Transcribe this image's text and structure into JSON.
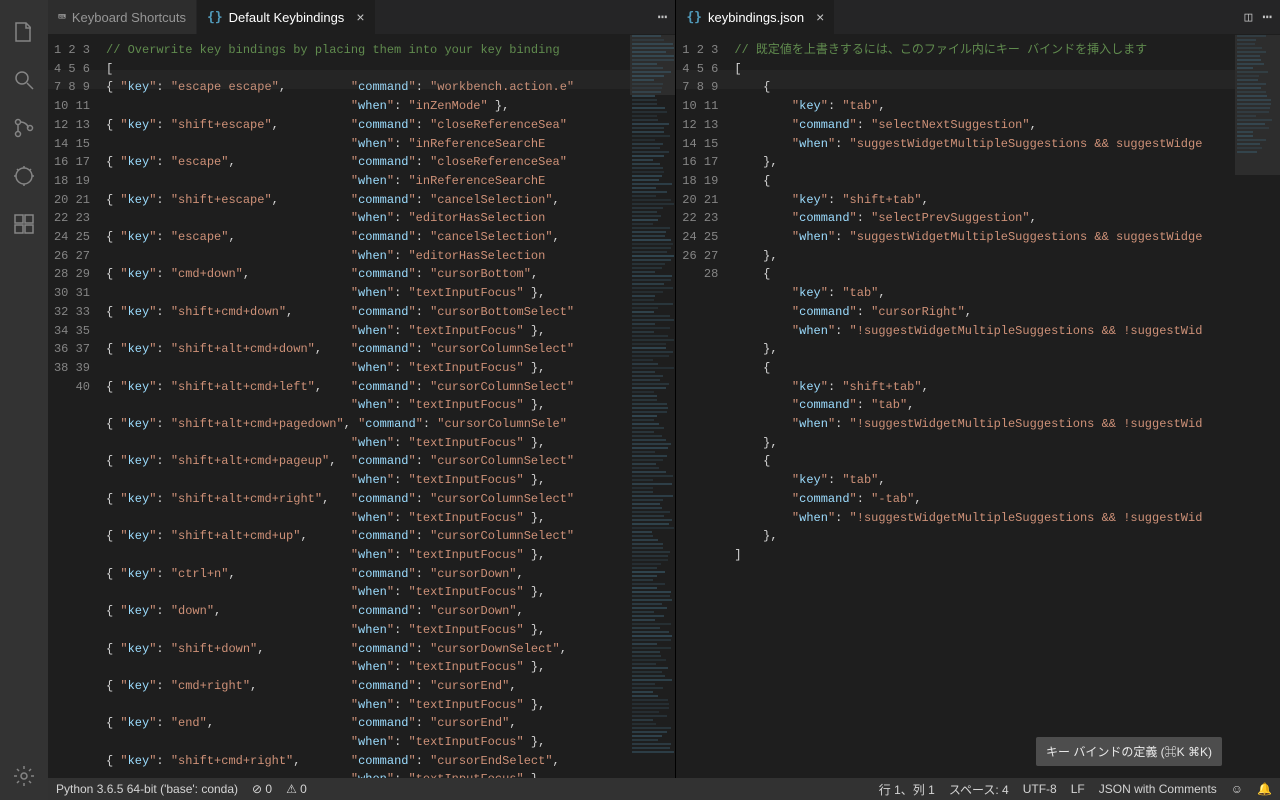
{
  "activity": {
    "icons": [
      "files",
      "search",
      "source-control",
      "debug",
      "extensions"
    ],
    "bottom": "settings-gear"
  },
  "tabs_left": [
    {
      "icon": "kbd",
      "label": "Keyboard Shortcuts",
      "active": false,
      "closable": false
    },
    {
      "icon": "json",
      "label": "Default Keybindings",
      "active": true,
      "closable": true
    }
  ],
  "tabs_right": [
    {
      "icon": "json",
      "label": "keybindings.json",
      "active": true,
      "closable": true
    }
  ],
  "left_editor": {
    "start_line": 1,
    "lines": [
      {
        "type": "comment",
        "text": "// Overwrite key bindings by placing them into your key binding"
      },
      {
        "type": "punc",
        "text": "["
      },
      {
        "type": "obj",
        "key": "escape escape",
        "command": "workbench.action.e",
        "more": true
      },
      {
        "type": "when",
        "when": "inZenMode",
        "close": true
      },
      {
        "type": "obj",
        "key": "shift+escape",
        "command": "closeReferenceSea",
        "more": true
      },
      {
        "type": "when",
        "when": "inReferenceSearchE",
        "trunc": true
      },
      {
        "type": "obj",
        "key": "escape",
        "command": "closeReferenceSea",
        "more": true
      },
      {
        "type": "when",
        "when": "inReferenceSearchE",
        "trunc": true
      },
      {
        "type": "obj",
        "key": "shift+escape",
        "command": "cancelSelection",
        "comma": true
      },
      {
        "type": "when",
        "when": "editorHasSelection",
        "trunc": true
      },
      {
        "type": "obj",
        "key": "escape",
        "command": "cancelSelection",
        "comma": true
      },
      {
        "type": "when",
        "when": "editorHasSelection",
        "trunc": true
      },
      {
        "type": "obj",
        "key": "cmd+down",
        "command": "cursorBottom",
        "comma": true
      },
      {
        "type": "when",
        "when": "textInputFocus",
        "close": true
      },
      {
        "type": "obj",
        "key": "shift+cmd+down",
        "command": "cursorBottomSelect",
        "more": true
      },
      {
        "type": "when",
        "when": "textInputFocus",
        "close": true
      },
      {
        "type": "obj",
        "key": "shift+alt+cmd+down",
        "command": "cursorColumnSelect",
        "more": true
      },
      {
        "type": "when",
        "when": "textInputFocus",
        "close": true
      },
      {
        "type": "obj",
        "key": "shift+alt+cmd+left",
        "command": "cursorColumnSelect",
        "more": true
      },
      {
        "type": "when",
        "when": "textInputFocus",
        "close": true
      },
      {
        "type": "obj",
        "key": "shift+alt+cmd+pagedown",
        "command": "cursorColumnSele",
        "more": true
      },
      {
        "type": "when",
        "when": "textInputFocus",
        "close": true
      },
      {
        "type": "obj",
        "key": "shift+alt+cmd+pageup",
        "command": "cursorColumnSelect",
        "more": true
      },
      {
        "type": "when",
        "when": "textInputFocus",
        "close": true
      },
      {
        "type": "obj",
        "key": "shift+alt+cmd+right",
        "command": "cursorColumnSelect",
        "more": true
      },
      {
        "type": "when",
        "when": "textInputFocus",
        "close": true
      },
      {
        "type": "obj",
        "key": "shift+alt+cmd+up",
        "command": "cursorColumnSelect",
        "more": true
      },
      {
        "type": "when",
        "when": "textInputFocus",
        "close": true
      },
      {
        "type": "obj",
        "key": "ctrl+n",
        "command": "cursorDown",
        "comma": true
      },
      {
        "type": "when",
        "when": "textInputFocus",
        "close": true
      },
      {
        "type": "obj",
        "key": "down",
        "command": "cursorDown",
        "comma": true
      },
      {
        "type": "when",
        "when": "textInputFocus",
        "close": true
      },
      {
        "type": "obj",
        "key": "shift+down",
        "command": "cursorDownSelect",
        "comma": true
      },
      {
        "type": "when",
        "when": "textInputFocus",
        "close": true
      },
      {
        "type": "obj",
        "key": "cmd+right",
        "command": "cursorEnd",
        "comma": true
      },
      {
        "type": "when",
        "when": "textInputFocus",
        "close": true
      },
      {
        "type": "obj",
        "key": "end",
        "command": "cursorEnd",
        "comma": true
      },
      {
        "type": "when",
        "when": "textInputFocus",
        "close": true
      },
      {
        "type": "obj",
        "key": "shift+cmd+right",
        "command": "cursorEndSelect",
        "comma": true
      },
      {
        "type": "when",
        "when": "textInputFocus",
        "close": true
      }
    ]
  },
  "right_editor": {
    "start_line": 1,
    "lines": [
      {
        "t": "comment",
        "s": "// 既定値を上書きするには、このファイル内にキー バインドを挿入します"
      },
      {
        "t": "raw",
        "s": "["
      },
      {
        "t": "raw",
        "s": "    {"
      },
      {
        "t": "kv",
        "k": "key",
        "v": "tab",
        "comma": true,
        "pad": "        "
      },
      {
        "t": "kv",
        "k": "command",
        "v": "selectNextSuggestion",
        "comma": true,
        "pad": "        "
      },
      {
        "t": "kv",
        "k": "when",
        "v": "suggestWidgetMultipleSuggestions && suggestWidge",
        "pad": "        ",
        "trunc": true
      },
      {
        "t": "raw",
        "s": "    },"
      },
      {
        "t": "raw",
        "s": "    {"
      },
      {
        "t": "kv",
        "k": "key",
        "v": "shift+tab",
        "comma": true,
        "pad": "        "
      },
      {
        "t": "kv",
        "k": "command",
        "v": "selectPrevSuggestion",
        "comma": true,
        "pad": "        "
      },
      {
        "t": "kv",
        "k": "when",
        "v": "suggestWidgetMultipleSuggestions && suggestWidge",
        "pad": "        ",
        "trunc": true
      },
      {
        "t": "raw",
        "s": "    },"
      },
      {
        "t": "raw",
        "s": "    {"
      },
      {
        "t": "kv",
        "k": "key",
        "v": "tab",
        "comma": true,
        "pad": "        "
      },
      {
        "t": "kv",
        "k": "command",
        "v": "cursorRight",
        "comma": true,
        "pad": "        "
      },
      {
        "t": "kv",
        "k": "when",
        "v": "!suggestWidgetMultipleSuggestions && !suggestWid",
        "pad": "        ",
        "trunc": true
      },
      {
        "t": "raw",
        "s": "    },"
      },
      {
        "t": "raw",
        "s": "    {"
      },
      {
        "t": "kv",
        "k": "key",
        "v": "shift+tab",
        "comma": true,
        "pad": "        "
      },
      {
        "t": "kv",
        "k": "command",
        "v": "tab",
        "comma": true,
        "pad": "        "
      },
      {
        "t": "kv",
        "k": "when",
        "v": "!suggestWidgetMultipleSuggestions && !suggestWid",
        "pad": "        ",
        "trunc": true
      },
      {
        "t": "raw",
        "s": "    },"
      },
      {
        "t": "raw",
        "s": "    {"
      },
      {
        "t": "kv",
        "k": "key",
        "v": "tab",
        "comma": true,
        "pad": "        "
      },
      {
        "t": "kv",
        "k": "command",
        "v": "-tab",
        "comma": true,
        "pad": "        "
      },
      {
        "t": "kv",
        "k": "when",
        "v": "!suggestWidgetMultipleSuggestions && !suggestWid",
        "pad": "        ",
        "trunc": true
      },
      {
        "t": "raw",
        "s": "    },"
      },
      {
        "t": "raw",
        "s": "]"
      }
    ]
  },
  "float_button": "キー バインドの定義 (⌘K ⌘K)",
  "status": {
    "python": "Python 3.6.5 64-bit ('base': conda)",
    "errors": "⊘ 0",
    "warnings": "⚠ 0",
    "lncol": "行 1、列 1",
    "spaces": "スペース: 4",
    "encoding": "UTF-8",
    "eol": "LF",
    "lang": "JSON with Comments",
    "smile": "☺",
    "bell": "🔔"
  }
}
